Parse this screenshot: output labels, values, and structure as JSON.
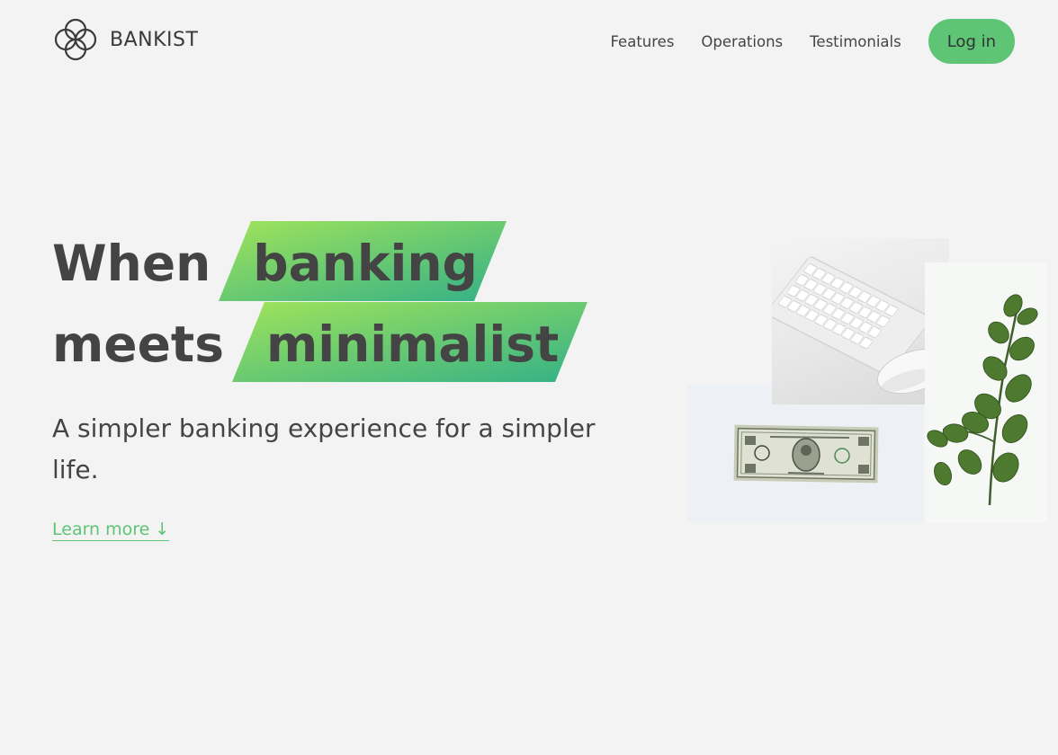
{
  "brand": {
    "name": "BANKIST",
    "logo_icon": "four-circles-logo-icon"
  },
  "nav": {
    "links": [
      "Features",
      "Operations",
      "Testimonials"
    ],
    "login_label": "Log in"
  },
  "hero": {
    "line1": {
      "word": "When",
      "highlight": "banking"
    },
    "line2": {
      "word": "meets",
      "highlight": "minimalist"
    },
    "subtitle": "A simpler banking experience for a simpler life.",
    "learn_more": "Learn more ↓"
  },
  "colors": {
    "accent": "#5ec576",
    "gradient_start": "#9be15d",
    "gradient_end": "#39b385",
    "text": "#444444",
    "background": "#f3f3f3"
  }
}
